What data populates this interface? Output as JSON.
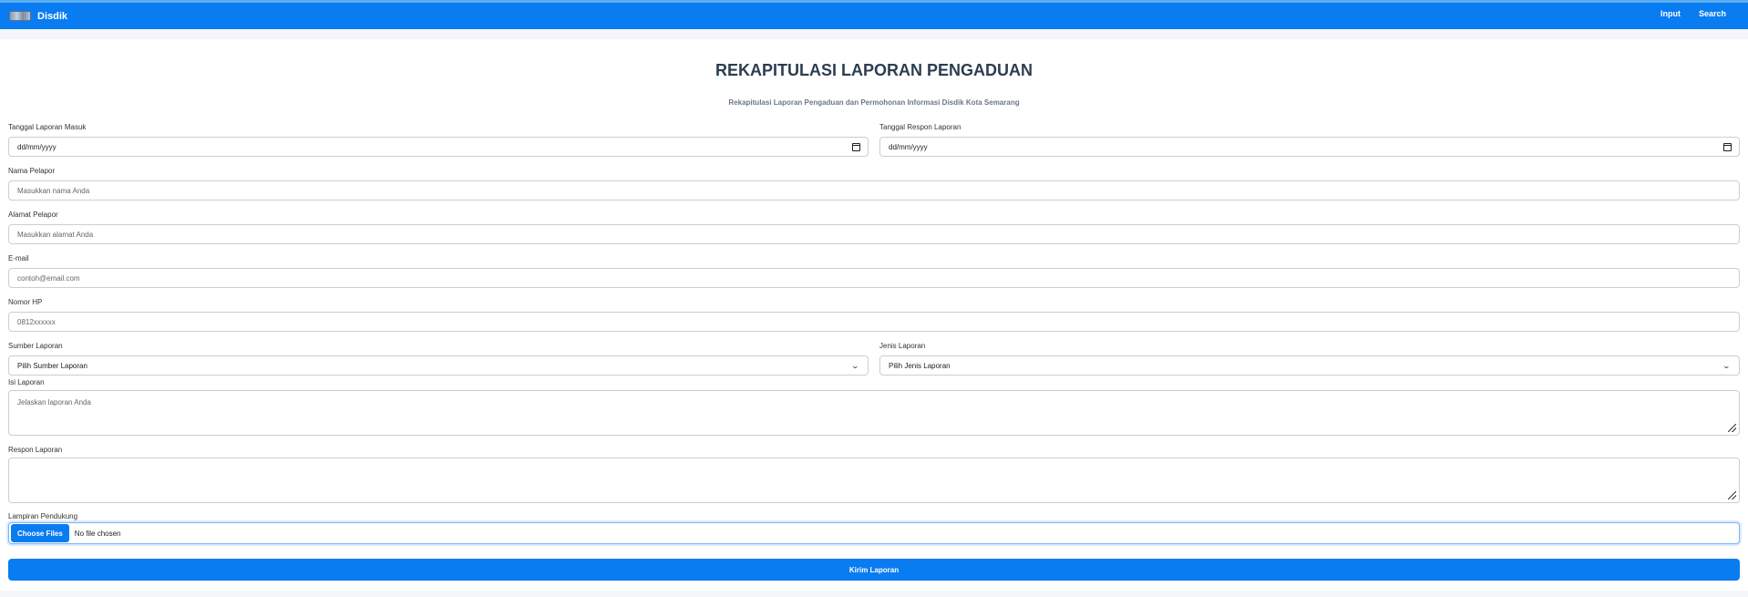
{
  "brand": {
    "name": "Disdik"
  },
  "nav": {
    "input": "Input",
    "search": "Search"
  },
  "page": {
    "title": "REKAPITULASI LAPORAN PENGADUAN",
    "subtitle": "Rekapitulasi Laporan Pengaduan dan Permohonan Informasi Disdik Kota Semarang"
  },
  "form": {
    "tanggal_masuk": {
      "label": "Tanggal Laporan Masuk",
      "value": "dd/mm/yyyy"
    },
    "tanggal_respon": {
      "label": "Tanggal Respon Laporan",
      "value": "dd/mm/yyyy"
    },
    "nama": {
      "label": "Nama Pelapor",
      "placeholder": "Masukkan nama Anda"
    },
    "alamat": {
      "label": "Alamat Pelapor",
      "placeholder": "Masukkan alamat Anda"
    },
    "email": {
      "label": "E-mail",
      "placeholder": "contoh@email.com"
    },
    "hp": {
      "label": "Nomor HP",
      "placeholder": "0812xxxxxx"
    },
    "sumber": {
      "label": "Sumber Laporan",
      "selected": "Pilih Sumber Laporan"
    },
    "jenis": {
      "label": "Jenis Laporan",
      "selected": "Pilih Jenis Laporan"
    },
    "isi": {
      "label": "Isi Laporan",
      "placeholder": "Jelaskan laporan Anda"
    },
    "respon": {
      "label": "Respon Laporan",
      "placeholder": ""
    },
    "lampiran": {
      "label": "Lampiran Pendukung",
      "button": "Choose Files",
      "status": "No file chosen"
    },
    "submit": "Kirim Laporan"
  },
  "colors": {
    "primary": "#0a7cf2",
    "title": "#2c3e50"
  },
  "icons": {
    "date": "calendar-icon",
    "select": "chevron-down-icon",
    "resize": "resize-handle-icon"
  }
}
